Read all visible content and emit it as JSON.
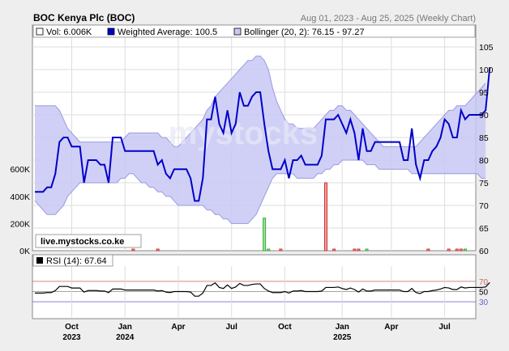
{
  "chart_data": [
    {
      "type": "line",
      "title": "BOC Kenya Plc (BOC)",
      "subtitle": "Aug 01, 2023 - Aug 25, 2025  (Weekly Chart)",
      "watermark": "live.mystocks.co.ke",
      "legend": {
        "placement": "top",
        "entries": [
          {
            "label": "Vol: 6.006K",
            "color": "#ffffff"
          },
          {
            "label": "Weighted Average: 100.5",
            "color": "#0000cc"
          },
          {
            "label": "Bollinger (20, 2): 76.15 - 97.27",
            "color": "#c8c8f5"
          }
        ]
      },
      "ylim": [
        60,
        105
      ],
      "yticks": [
        "60",
        "65",
        "70",
        "75",
        "80",
        "85",
        "90",
        "95",
        "100",
        "105"
      ],
      "volume_ticks": [
        "0K",
        "200K",
        "400K",
        "600K"
      ],
      "volume_max": 1500000,
      "xticks": [
        {
          "month": "Oct",
          "year": "2023",
          "week": 9
        },
        {
          "month": "Jan",
          "year": "2024",
          "week": 22
        },
        {
          "month": "Apr",
          "year": "",
          "week": 35
        },
        {
          "month": "Jul",
          "year": "",
          "week": 48
        },
        {
          "month": "Oct",
          "year": "",
          "week": 61
        },
        {
          "month": "Jan",
          "year": "2025",
          "week": 75
        },
        {
          "month": "Apr",
          "year": "",
          "week": 87
        },
        {
          "month": "Jul",
          "year": "",
          "week": 100
        },
        {
          "week_count": 108
        }
      ],
      "grid": true,
      "series": [
        {
          "name": "Weighted Average",
          "color": "#0000cc",
          "values": [
            73,
            73,
            73,
            74,
            74,
            77,
            84,
            85,
            85,
            83,
            83,
            83,
            75,
            80,
            80,
            80,
            79,
            79,
            75,
            85,
            85,
            85,
            82,
            82,
            82,
            82,
            82,
            82,
            82,
            82,
            79,
            80,
            77,
            76,
            78,
            78,
            78,
            78,
            76,
            71,
            71,
            76,
            89,
            89,
            94,
            88,
            86,
            91,
            86,
            88,
            95,
            92,
            92,
            94,
            95,
            95,
            88,
            82,
            78,
            78,
            78,
            80,
            76,
            80,
            80,
            81,
            79,
            79,
            79,
            79,
            81,
            89,
            89,
            89,
            90,
            88,
            86,
            89,
            86,
            80,
            87,
            82,
            82,
            84,
            84,
            84,
            84,
            84,
            84,
            84,
            80,
            80,
            87,
            79,
            76,
            80,
            80,
            82,
            83,
            85,
            89,
            88,
            85,
            85,
            91,
            89,
            90,
            90,
            90,
            90,
            91,
            100.5
          ]
        },
        {
          "name": "Bollinger Upper",
          "color": "#b4b4ee",
          "values": [
            92,
            92,
            92,
            92,
            92,
            92,
            91,
            89,
            87,
            86,
            85,
            84,
            84,
            84,
            84,
            84,
            84,
            84,
            84,
            84,
            84,
            84,
            85,
            86,
            86,
            86,
            86,
            86,
            86,
            86,
            86,
            85,
            85,
            84,
            83,
            83,
            84,
            85,
            86,
            87,
            88,
            89,
            91,
            92,
            94,
            95,
            96,
            97,
            98,
            99,
            100,
            101,
            102,
            102,
            103,
            103,
            102,
            100,
            96,
            93,
            91,
            89,
            88,
            88,
            87,
            87,
            87,
            87,
            87,
            88,
            89,
            90,
            91,
            91,
            92,
            92,
            91,
            91,
            90,
            89,
            88,
            87,
            86,
            85,
            84,
            83,
            83,
            83,
            83,
            83,
            83,
            83,
            83,
            83,
            84,
            85,
            86,
            87,
            88,
            89,
            90,
            91,
            91,
            92,
            92,
            92,
            93,
            94,
            95,
            96,
            97
          ]
        },
        {
          "name": "Bollinger Lower",
          "color": "#b4b4ee",
          "values": [
            71,
            70,
            69,
            68,
            68,
            68,
            69,
            70,
            72,
            73,
            74,
            75,
            75,
            75,
            75,
            75,
            75,
            75,
            75,
            75,
            75,
            76,
            76,
            77,
            77,
            76,
            75,
            75,
            74,
            74,
            73,
            73,
            72,
            72,
            71,
            70,
            70,
            70,
            70,
            70,
            70,
            70,
            69,
            69,
            68,
            68,
            67,
            67,
            66,
            66,
            66,
            66,
            66,
            67,
            68,
            70,
            72,
            74,
            76,
            77,
            77,
            77,
            77,
            77,
            76,
            76,
            76,
            76,
            76,
            77,
            77,
            78,
            78,
            79,
            79,
            80,
            80,
            80,
            80,
            80,
            80,
            79,
            79,
            79,
            78,
            78,
            78,
            78,
            78,
            78,
            78,
            78,
            77,
            77,
            77,
            77,
            77,
            77,
            77,
            77,
            77,
            77,
            77,
            77,
            77,
            77,
            77,
            77,
            77,
            76,
            76
          ]
        },
        {
          "name": "Volume",
          "color": "#cc3333",
          "values": [
            0,
            0,
            0,
            0,
            0,
            0,
            0,
            0,
            0,
            0,
            0,
            0,
            0,
            0,
            0,
            0,
            0,
            0,
            0,
            0,
            0,
            0,
            0,
            0,
            0,
            0,
            0,
            0,
            0,
            0,
            0,
            0,
            0,
            0,
            0,
            0,
            0,
            0,
            0,
            0,
            0,
            0,
            0,
            0,
            0,
            0,
            0,
            0,
            0,
            0,
            0,
            0,
            0,
            0,
            0,
            0,
            0,
            0,
            0,
            0,
            0,
            0,
            0,
            0,
            0,
            0,
            0,
            0,
            0,
            0,
            0,
            0,
            0,
            0,
            0,
            0,
            0,
            0,
            0,
            0,
            0,
            0,
            0,
            0,
            0,
            0,
            0,
            0,
            0,
            0,
            0,
            0,
            0,
            0,
            0,
            0,
            0,
            0,
            0,
            0,
            0,
            0,
            0,
            0,
            0,
            0,
            0,
            0,
            0,
            0,
            0,
            0
          ]
        }
      ],
      "volume_bars": [
        {
          "week": 24,
          "value": 8000,
          "color": "#cc3333"
        },
        {
          "week": 30,
          "value": 12000,
          "color": "#cc3333"
        },
        {
          "week": 56,
          "value": 240000,
          "color": "#33aa33"
        },
        {
          "week": 57,
          "value": 8000,
          "color": "#33aa33"
        },
        {
          "week": 60,
          "value": 6000,
          "color": "#cc3333"
        },
        {
          "week": 71,
          "value": 500000,
          "color": "#cc3333"
        },
        {
          "week": 73,
          "value": 8000,
          "color": "#cc3333"
        },
        {
          "week": 78,
          "value": 10000,
          "color": "#cc3333"
        },
        {
          "week": 79,
          "value": 6000,
          "color": "#cc3333"
        },
        {
          "week": 81,
          "value": 6000,
          "color": "#33aa33"
        },
        {
          "week": 96,
          "value": 6000,
          "color": "#cc3333"
        },
        {
          "week": 101,
          "value": 6000,
          "color": "#cc3333"
        },
        {
          "week": 103,
          "value": 6000,
          "color": "#cc3333"
        },
        {
          "week": 104,
          "value": 6000,
          "color": "#cc3333"
        },
        {
          "week": 105,
          "value": 6000,
          "color": "#33aa33"
        }
      ]
    },
    {
      "type": "line",
      "title": "RSI (14): 67.64",
      "ylim": [
        0,
        100
      ],
      "reference_lines": [
        {
          "value": 70,
          "label": "70",
          "color": "#cc6666"
        },
        {
          "value": 50,
          "label": "50",
          "color": "#000000"
        },
        {
          "value": 30,
          "label": "30",
          "color": "#6666cc"
        }
      ],
      "series": [
        {
          "name": "RSI",
          "color": "#000000",
          "values": [
            47,
            47,
            47,
            48,
            48,
            52,
            60,
            60,
            60,
            57,
            57,
            57,
            49,
            52,
            52,
            52,
            51,
            51,
            48,
            55,
            55,
            55,
            53,
            53,
            53,
            53,
            53,
            53,
            53,
            53,
            51,
            52,
            49,
            48,
            50,
            50,
            50,
            50,
            49,
            41,
            41,
            47,
            62,
            62,
            67,
            58,
            56,
            63,
            56,
            59,
            66,
            62,
            62,
            64,
            65,
            65,
            56,
            51,
            48,
            48,
            48,
            50,
            47,
            51,
            51,
            52,
            50,
            50,
            50,
            50,
            51,
            58,
            58,
            58,
            59,
            56,
            54,
            57,
            54,
            49,
            55,
            51,
            51,
            53,
            53,
            53,
            53,
            53,
            53,
            53,
            50,
            50,
            56,
            48,
            46,
            50,
            50,
            52,
            53,
            55,
            58,
            57,
            54,
            54,
            59,
            57,
            58,
            58,
            58,
            58,
            59,
            67.64
          ]
        }
      ]
    }
  ]
}
